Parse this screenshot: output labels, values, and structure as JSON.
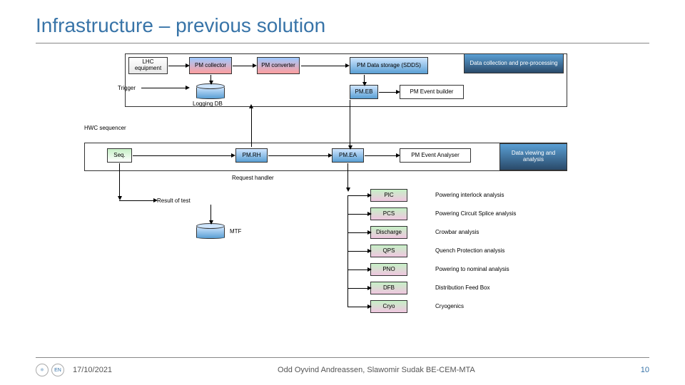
{
  "slide": {
    "title": "Infrastructure – previous solution",
    "date": "17/10/2021",
    "author": "Odd Oyvind Andreassen, Slawomir Sudak BE-CEM-MTA",
    "page": "10"
  },
  "blocks": {
    "lhc": "LHC equipment",
    "pmcol": "PM collector",
    "pmconv": "PM converter",
    "pmds": "PM Data storage (SDDS)",
    "dcp": "Data collection and pre-processing",
    "trigger": "Trigger",
    "logdb": "Logging DB",
    "pmeb": "PM.EB",
    "pmevb": "PM Event builder",
    "hwc": "HWC sequencer",
    "seq": "Seq.",
    "pmrh": "PM.RH",
    "pmea": "PM.EA",
    "pmevan": "PM Event Analyser",
    "dva": "Data viewing and analysis",
    "reqh": "Request handler",
    "rot": "Result of test",
    "mtf": "MTF"
  },
  "analyses": [
    {
      "code": "PIC",
      "desc": "Powering interlock analysis"
    },
    {
      "code": "PCS",
      "desc": "Powering Circuit Splice analysis"
    },
    {
      "code": "Discharge",
      "desc": "Crowbar analysis"
    },
    {
      "code": "QPS",
      "desc": "Quench Protection analysis"
    },
    {
      "code": "PNO",
      "desc": "Powering to nominal analysis"
    },
    {
      "code": "DFB",
      "desc": "Distribution Feed Box"
    },
    {
      "code": "Cryo",
      "desc": "Cryogenics"
    }
  ]
}
